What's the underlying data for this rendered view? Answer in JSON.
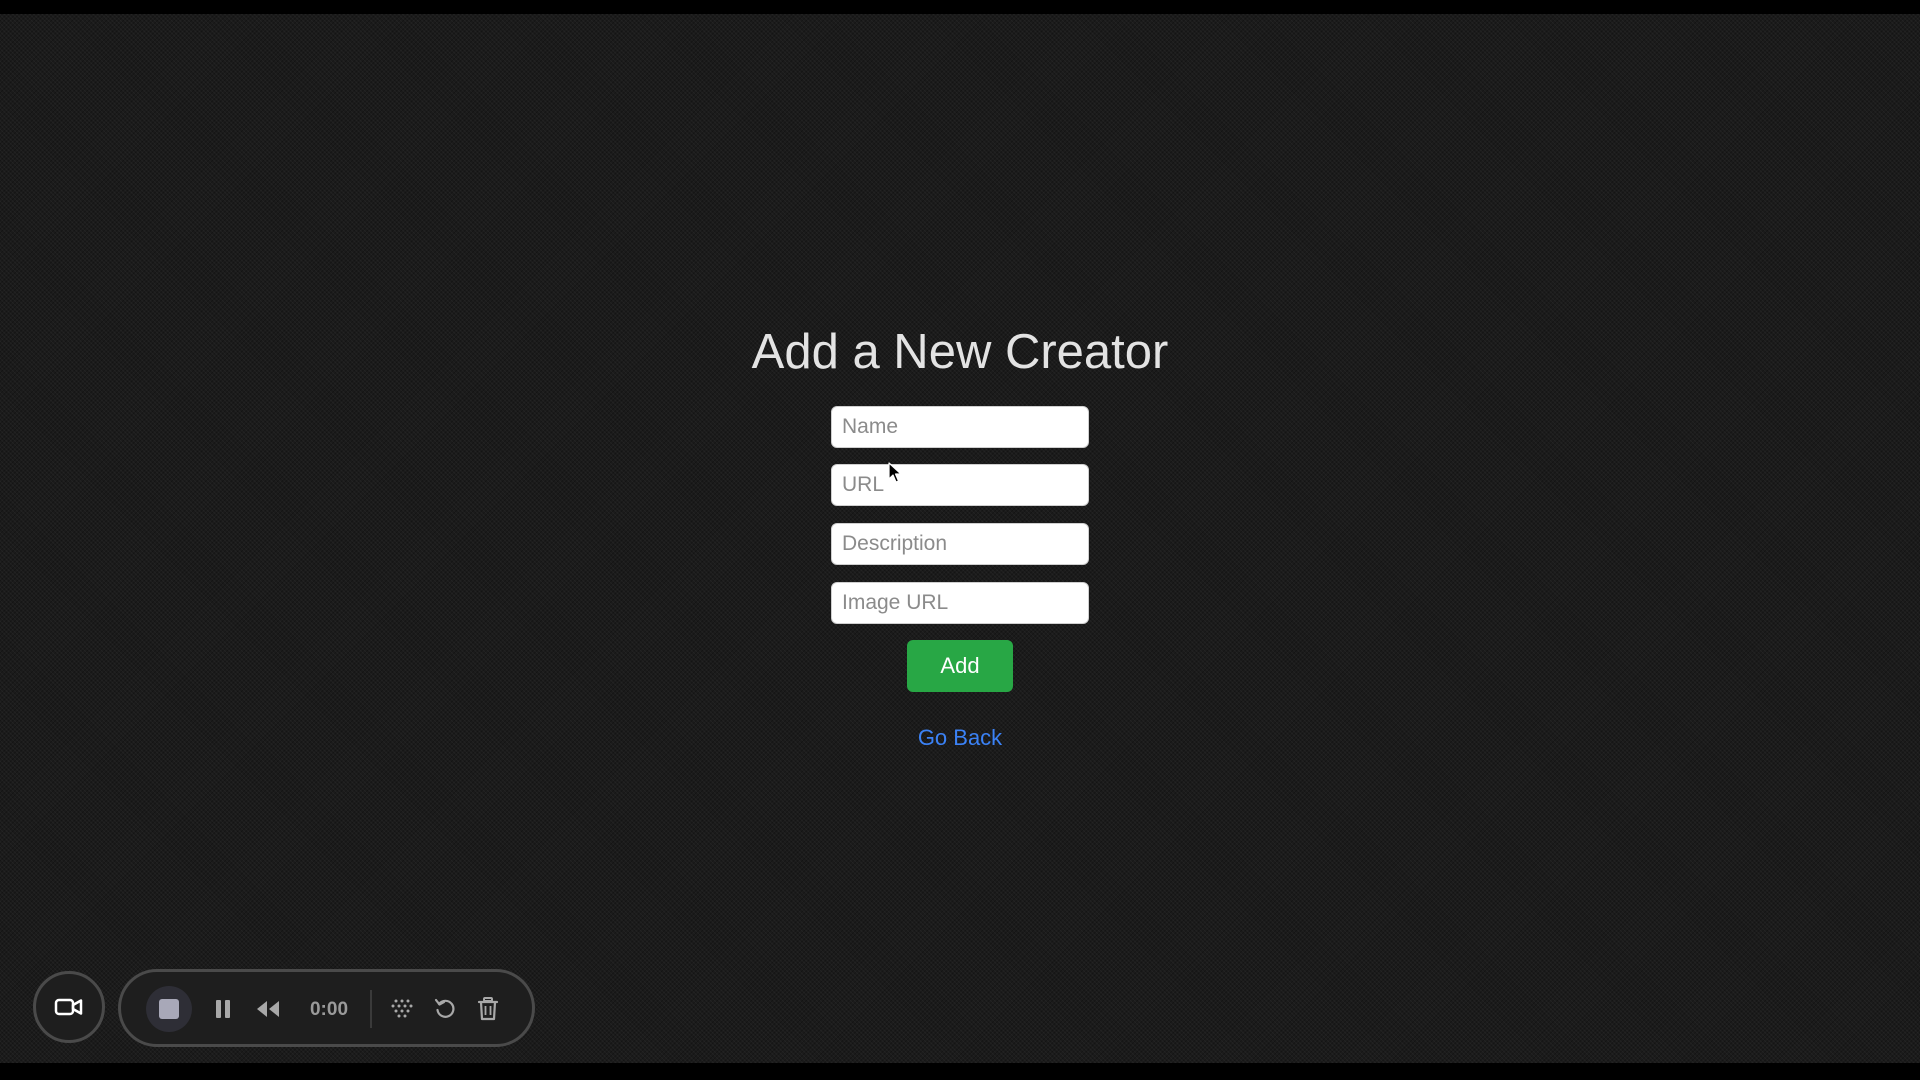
{
  "page": {
    "title": "Add a New Creator",
    "fields": {
      "name_placeholder": "Name",
      "url_placeholder": "URL",
      "description_placeholder": "Description",
      "image_url_placeholder": "Image URL"
    },
    "add_button_label": "Add",
    "go_back_label": "Go Back"
  },
  "recorder": {
    "timer": "0:00",
    "icons": [
      "video-camera-icon",
      "stop-icon",
      "pause-icon",
      "rewind-icon",
      "grid-icon",
      "restart-icon",
      "trash-icon"
    ]
  },
  "colors": {
    "background": "#1b1b1b",
    "title_text": "#e3e3e3",
    "add_button": "#28a745",
    "link": "#3b82f6",
    "recorder_bg": "#1e1e1e"
  }
}
